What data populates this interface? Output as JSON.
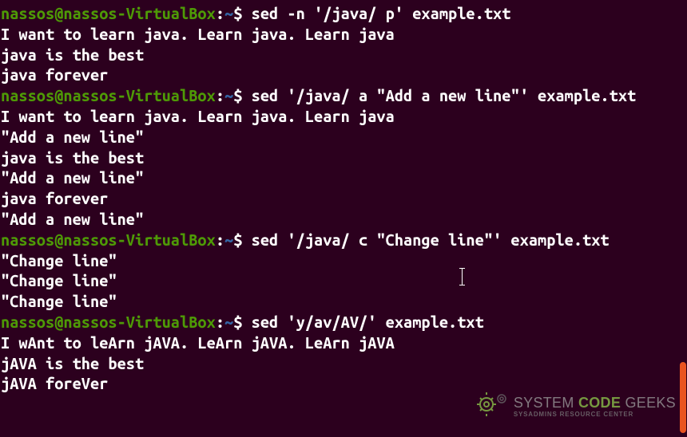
{
  "prompt": {
    "user": "nassos",
    "sep_user_host": "@",
    "host": "nassos-VirtualBox",
    "sep_host_path": ":",
    "path": "~",
    "dollar": "$ "
  },
  "blocks": {
    "b1": {
      "cmd": "sed -n '/java/ p' example.txt",
      "out1": "I want to learn java. Learn java. Learn java",
      "out2": "java is the best",
      "out3": "java forever"
    },
    "b2": {
      "cmd": "sed '/java/ a \"Add a new line\"' example.txt",
      "out1": "I want to learn java. Learn java. Learn java",
      "out2": "\"Add a new line\"",
      "out3": "java is the best",
      "out4": "\"Add a new line\"",
      "out5": "java forever",
      "out6": "\"Add a new line\""
    },
    "b3": {
      "cmd": "sed '/java/ c \"Change line\"' example.txt",
      "out1": "\"Change line\"",
      "out2": "\"Change line\"",
      "out3": "\"Change line\""
    },
    "b4": {
      "cmd": "sed 'y/av/AV/' example.txt",
      "out1": "I wAnt to leArn jAVA. LeArn jAVA. LeArn jAVA",
      "out2": "jAVA is the best",
      "out3": "jAVA foreVer"
    }
  },
  "watermark": {
    "sys": "SYSTEM ",
    "code": "CODE ",
    "geeks": "GEEKS",
    "sub": "SYSADMINS RESOURCE CENTER"
  }
}
